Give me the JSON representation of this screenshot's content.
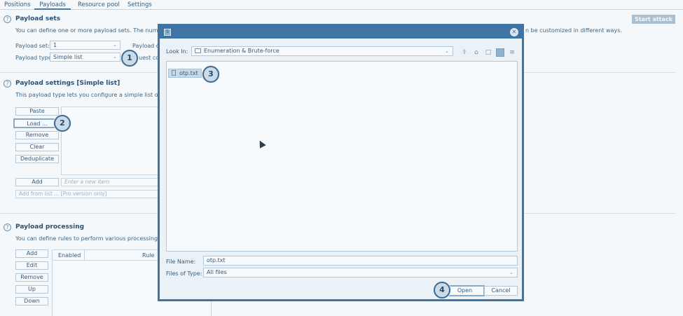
{
  "tabs": [
    "Positions",
    "Payloads",
    "Resource pool",
    "Settings"
  ],
  "start_attack": "Start attack",
  "payload_sets": {
    "title": "Payload sets",
    "desc_left": "You can define one or more payload sets. The number of p",
    "desc_right": "n be customized in different ways.",
    "set_label": "Payload set:",
    "set_value": "1",
    "count_label": "Payload co",
    "type_label": "Payload type:",
    "type_value": "Simple list",
    "request_label": "uest co"
  },
  "payload_settings": {
    "title": "Payload settings [Simple list]",
    "desc": "This payload type lets you configure a simple list of string",
    "buttons": [
      "Paste",
      "Load ...",
      "Remove",
      "Clear",
      "Deduplicate"
    ],
    "add": "Add",
    "add_placeholder": "Enter a new item",
    "add_from_list": "Add from list ... [Pro version only]"
  },
  "payload_processing": {
    "title": "Payload processing",
    "desc": "You can define rules to perform various processing tasks",
    "buttons": [
      "Add",
      "Edit",
      "Remove",
      "Up",
      "Down"
    ],
    "col_enabled": "Enabled",
    "col_rule": "Rule"
  },
  "dialog": {
    "app_icon": "S",
    "look_in_label": "Look In:",
    "look_in_value": "Enumeration & Brute-force",
    "files": [
      "otp.txt"
    ],
    "file_name_label": "File Name:",
    "file_name_value": "otp.txt",
    "file_type_label": "Files of Type:",
    "file_type_value": "All files",
    "open": "Open",
    "cancel": "Cancel"
  },
  "badges": [
    "1",
    "2",
    "3",
    "4"
  ],
  "colors": {
    "accent": "#3f74a3",
    "badge_border": "#3f6a90",
    "text": "#3a5a76"
  }
}
